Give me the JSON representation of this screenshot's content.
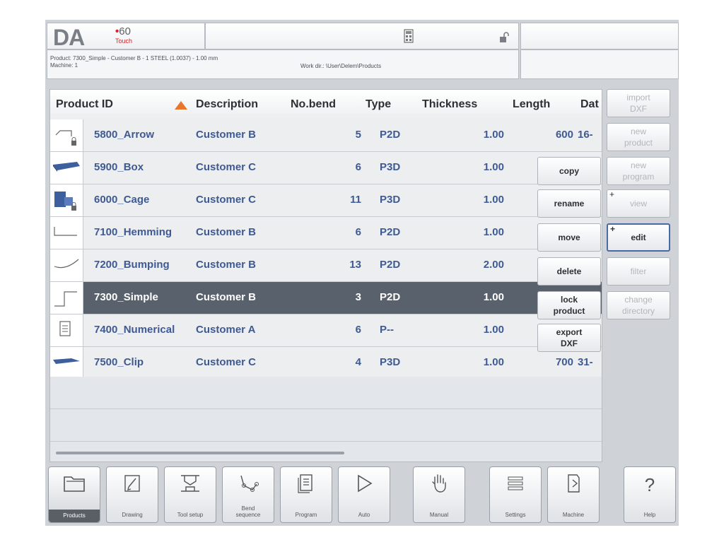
{
  "header": {
    "logo_da": "DA",
    "logo_model": "60",
    "logo_touch": "Touch",
    "product_line": "Product: 7300_Simple - Customer B - 1 STEEL (1.0037) - 1.00 mm",
    "machine_line": "Machine: 1",
    "work_dir": "Work dir.: \\User\\Delem\\Products",
    "icons": [
      "calculator-icon",
      "unlocked-padlock-icon"
    ]
  },
  "table": {
    "columns": [
      "Product ID",
      "Description",
      "No.bend",
      "Type",
      "Thickness",
      "Length",
      "Dat"
    ],
    "sort_column": "Product ID",
    "sort_direction": "ascending",
    "rows": [
      {
        "id": "5800_Arrow",
        "desc": "Customer B",
        "bends": "5",
        "type": "P2D",
        "thick": "1.00",
        "length": "600",
        "date": "16-",
        "thumb": "arrow-profile",
        "locked": true
      },
      {
        "id": "5900_Box",
        "desc": "Customer C",
        "bends": "6",
        "type": "P3D",
        "thick": "1.00",
        "length": "",
        "date": "",
        "thumb": "box-3d",
        "locked": false
      },
      {
        "id": "6000_Cage",
        "desc": "Customer C",
        "bends": "11",
        "type": "P3D",
        "thick": "1.00",
        "length": "",
        "date": "",
        "thumb": "cage-3d",
        "locked": true
      },
      {
        "id": "7100_Hemming",
        "desc": "Customer B",
        "bends": "6",
        "type": "P2D",
        "thick": "1.00",
        "length": "",
        "date": "",
        "thumb": "hem-profile",
        "locked": false
      },
      {
        "id": "7200_Bumping",
        "desc": "Customer B",
        "bends": "13",
        "type": "P2D",
        "thick": "2.00",
        "length": "",
        "date": "",
        "thumb": "curve-profile",
        "locked": false
      },
      {
        "id": "7300_Simple",
        "desc": "Customer B",
        "bends": "3",
        "type": "P2D",
        "thick": "1.00",
        "length": "",
        "date": "",
        "thumb": "step-profile",
        "locked": false,
        "selected": true
      },
      {
        "id": "7400_Numerical",
        "desc": "Customer A",
        "bends": "6",
        "type": "P--",
        "thick": "1.00",
        "length": "",
        "date": "",
        "thumb": "document",
        "locked": false
      },
      {
        "id": "7500_Clip",
        "desc": "Customer C",
        "bends": "4",
        "type": "P3D",
        "thick": "1.00",
        "length": "700",
        "date": "31-",
        "thumb": "clip-3d",
        "locked": false
      }
    ]
  },
  "context_menu": {
    "copy": "copy",
    "rename": "rename",
    "move": "move",
    "delete": "delete",
    "lock_line1": "lock",
    "lock_line2": "product",
    "export_line1": "export",
    "export_line2": "DXF"
  },
  "sidebar": {
    "import_line1": "import",
    "import_line2": "DXF",
    "new_product_line1": "new",
    "new_product_line2": "product",
    "new_program_line1": "new",
    "new_program_line2": "program",
    "view": "view",
    "edit": "edit",
    "filter": "filter",
    "change_dir_line1": "change",
    "change_dir_line2": "directory"
  },
  "bottom_nav": [
    {
      "label": "Products",
      "icon": "folder-icon",
      "active": true
    },
    {
      "label": "Drawing",
      "icon": "pencil-icon",
      "active": false
    },
    {
      "label": "Tool setup",
      "icon": "tool-setup-icon",
      "active": false
    },
    {
      "label1": "Bend",
      "label2": "sequence",
      "icon": "bend-sequence-icon",
      "active": false
    },
    {
      "label": "Program",
      "icon": "program-pages-icon",
      "active": false
    },
    {
      "label": "Auto",
      "icon": "play-icon",
      "active": false
    },
    {
      "label": "Manual",
      "icon": "hand-icon",
      "active": false
    },
    {
      "label": "Settings",
      "icon": "settings-list-icon",
      "active": false
    },
    {
      "label": "Machine",
      "icon": "machine-icon",
      "active": false
    },
    {
      "label": "Help",
      "icon": "help-icon",
      "active": false
    }
  ],
  "colors": {
    "accent_text": "#3f5a92",
    "selected_row": "#58616c",
    "sort_arrow": "#e8762b",
    "brand_red": "#d2252a"
  }
}
